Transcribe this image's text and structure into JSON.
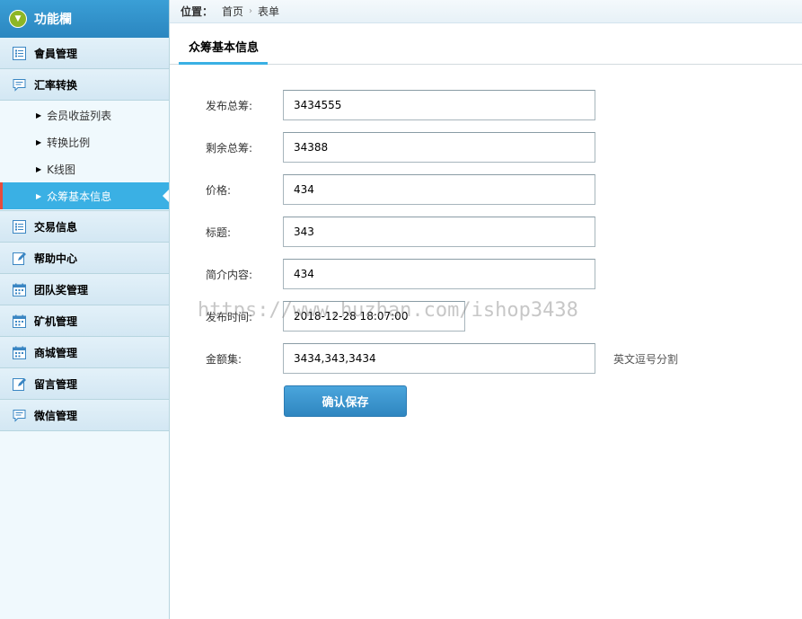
{
  "sidebar": {
    "title": "功能欄",
    "groups": [
      {
        "label": "會員管理",
        "icon": "list-icon"
      },
      {
        "label": "汇率转换",
        "icon": "chat-icon"
      },
      {
        "label": "交易信息",
        "icon": "list-icon"
      },
      {
        "label": "帮助中心",
        "icon": "edit-icon"
      },
      {
        "label": "团队奖管理",
        "icon": "calendar-icon"
      },
      {
        "label": "矿机管理",
        "icon": "calendar-icon"
      },
      {
        "label": "商城管理",
        "icon": "calendar-icon"
      },
      {
        "label": "留言管理",
        "icon": "edit-icon"
      },
      {
        "label": "微信管理",
        "icon": "chat-icon"
      }
    ],
    "sub_items": [
      {
        "label": "会员收益列表"
      },
      {
        "label": "转换比例"
      },
      {
        "label": "K线图"
      },
      {
        "label": "众筹基本信息",
        "active": true
      }
    ]
  },
  "breadcrumb": {
    "prefix": "位置：",
    "home": "首页",
    "current": "表单"
  },
  "tab": {
    "label": "众筹基本信息"
  },
  "form": {
    "fields": [
      {
        "label": "发布总筹:",
        "value": "3434555"
      },
      {
        "label": "剩余总筹:",
        "value": "34388"
      },
      {
        "label": "价格:",
        "value": "434"
      },
      {
        "label": "标题:",
        "value": "343"
      },
      {
        "label": "简介内容:",
        "value": "434"
      },
      {
        "label": "发布时间:",
        "value": "2018-12-28 18:07:00"
      },
      {
        "label": "金额集:",
        "value": "3434,343,3434",
        "hint": "英文逗号分割"
      }
    ],
    "save_label": "确认保存"
  },
  "watermark": "https://www.huzhan.com/ishop3438",
  "colors": {
    "accent": "#3ab0e4",
    "header": "#2b86c0",
    "active_marker": "#e74c3c"
  }
}
